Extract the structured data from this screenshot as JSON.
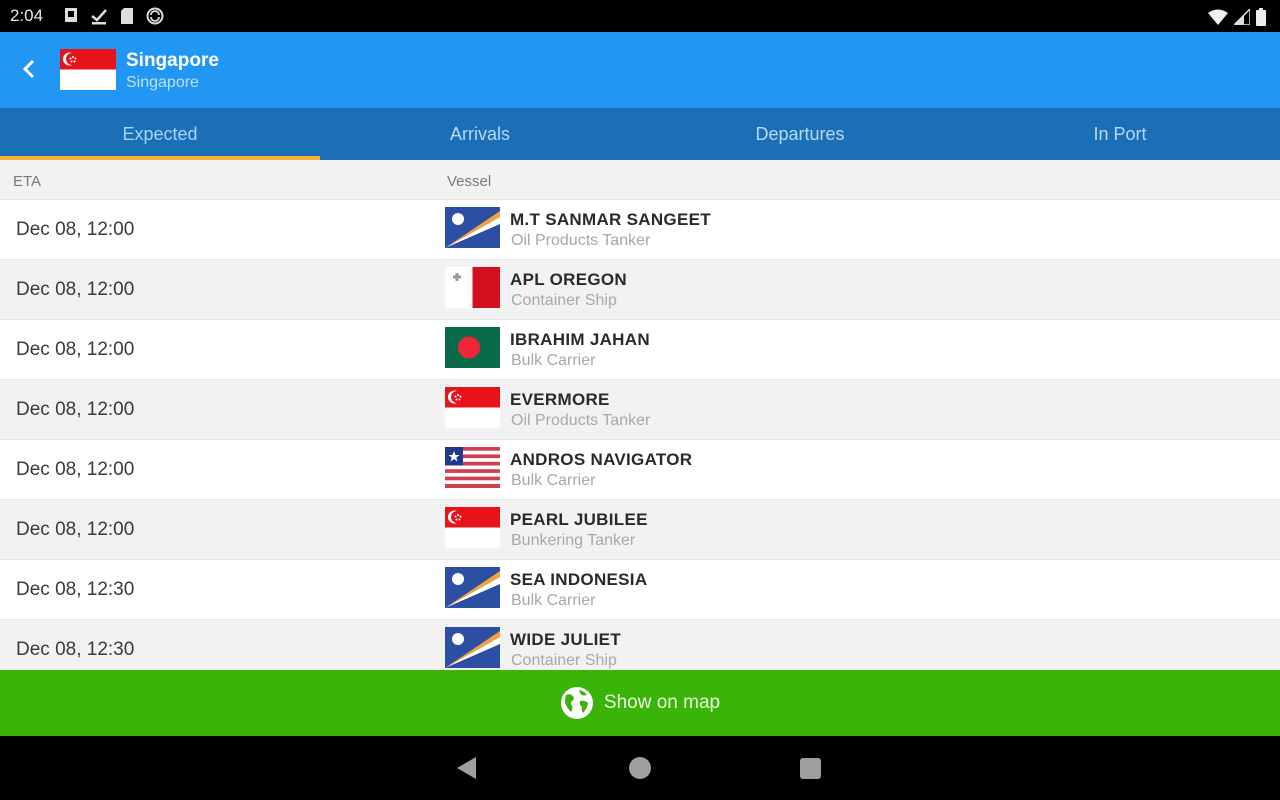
{
  "status_bar": {
    "time": "2:04",
    "left_icons": [
      "notification-icon",
      "download-done-icon",
      "sd-card-icon",
      "sync-icon"
    ],
    "right_icons": [
      "wifi-icon",
      "cell-signal-icon",
      "battery-icon"
    ]
  },
  "header": {
    "title": "Singapore",
    "subtitle": "Singapore",
    "flag": "singapore-flag"
  },
  "tabs": [
    {
      "label": "Expected",
      "active": true
    },
    {
      "label": "Arrivals",
      "active": false
    },
    {
      "label": "Departures",
      "active": false
    },
    {
      "label": "In Port",
      "active": false
    }
  ],
  "columns": {
    "eta": "ETA",
    "vessel": "Vessel"
  },
  "vessels": [
    {
      "eta": "Dec 08, 12:00",
      "name": "M.T SANMAR SANGEET",
      "type": "Oil Products Tanker",
      "flag": "marshall-islands"
    },
    {
      "eta": "Dec 08, 12:00",
      "name": "APL OREGON",
      "type": "Container Ship",
      "flag": "malta"
    },
    {
      "eta": "Dec 08, 12:00",
      "name": "IBRAHIM JAHAN",
      "type": "Bulk Carrier",
      "flag": "bangladesh"
    },
    {
      "eta": "Dec 08, 12:00",
      "name": "EVERMORE",
      "type": "Oil Products Tanker",
      "flag": "singapore"
    },
    {
      "eta": "Dec 08, 12:00",
      "name": "ANDROS NAVIGATOR",
      "type": "Bulk Carrier",
      "flag": "liberia"
    },
    {
      "eta": "Dec 08, 12:00",
      "name": "PEARL JUBILEE",
      "type": "Bunkering Tanker",
      "flag": "singapore"
    },
    {
      "eta": "Dec 08, 12:30",
      "name": "SEA INDONESIA",
      "type": "Bulk Carrier",
      "flag": "marshall-islands"
    },
    {
      "eta": "Dec 08, 12:30",
      "name": "WIDE JULIET",
      "type": "Container Ship",
      "flag": "marshall-islands"
    }
  ],
  "map_button": {
    "label": "Show on map",
    "icon": "globe-icon"
  },
  "colors": {
    "app_bar": "#2196f3",
    "tab_bar": "#1a6fb7",
    "tab_indicator": "#f4b234",
    "map_button": "#3bb40a"
  }
}
